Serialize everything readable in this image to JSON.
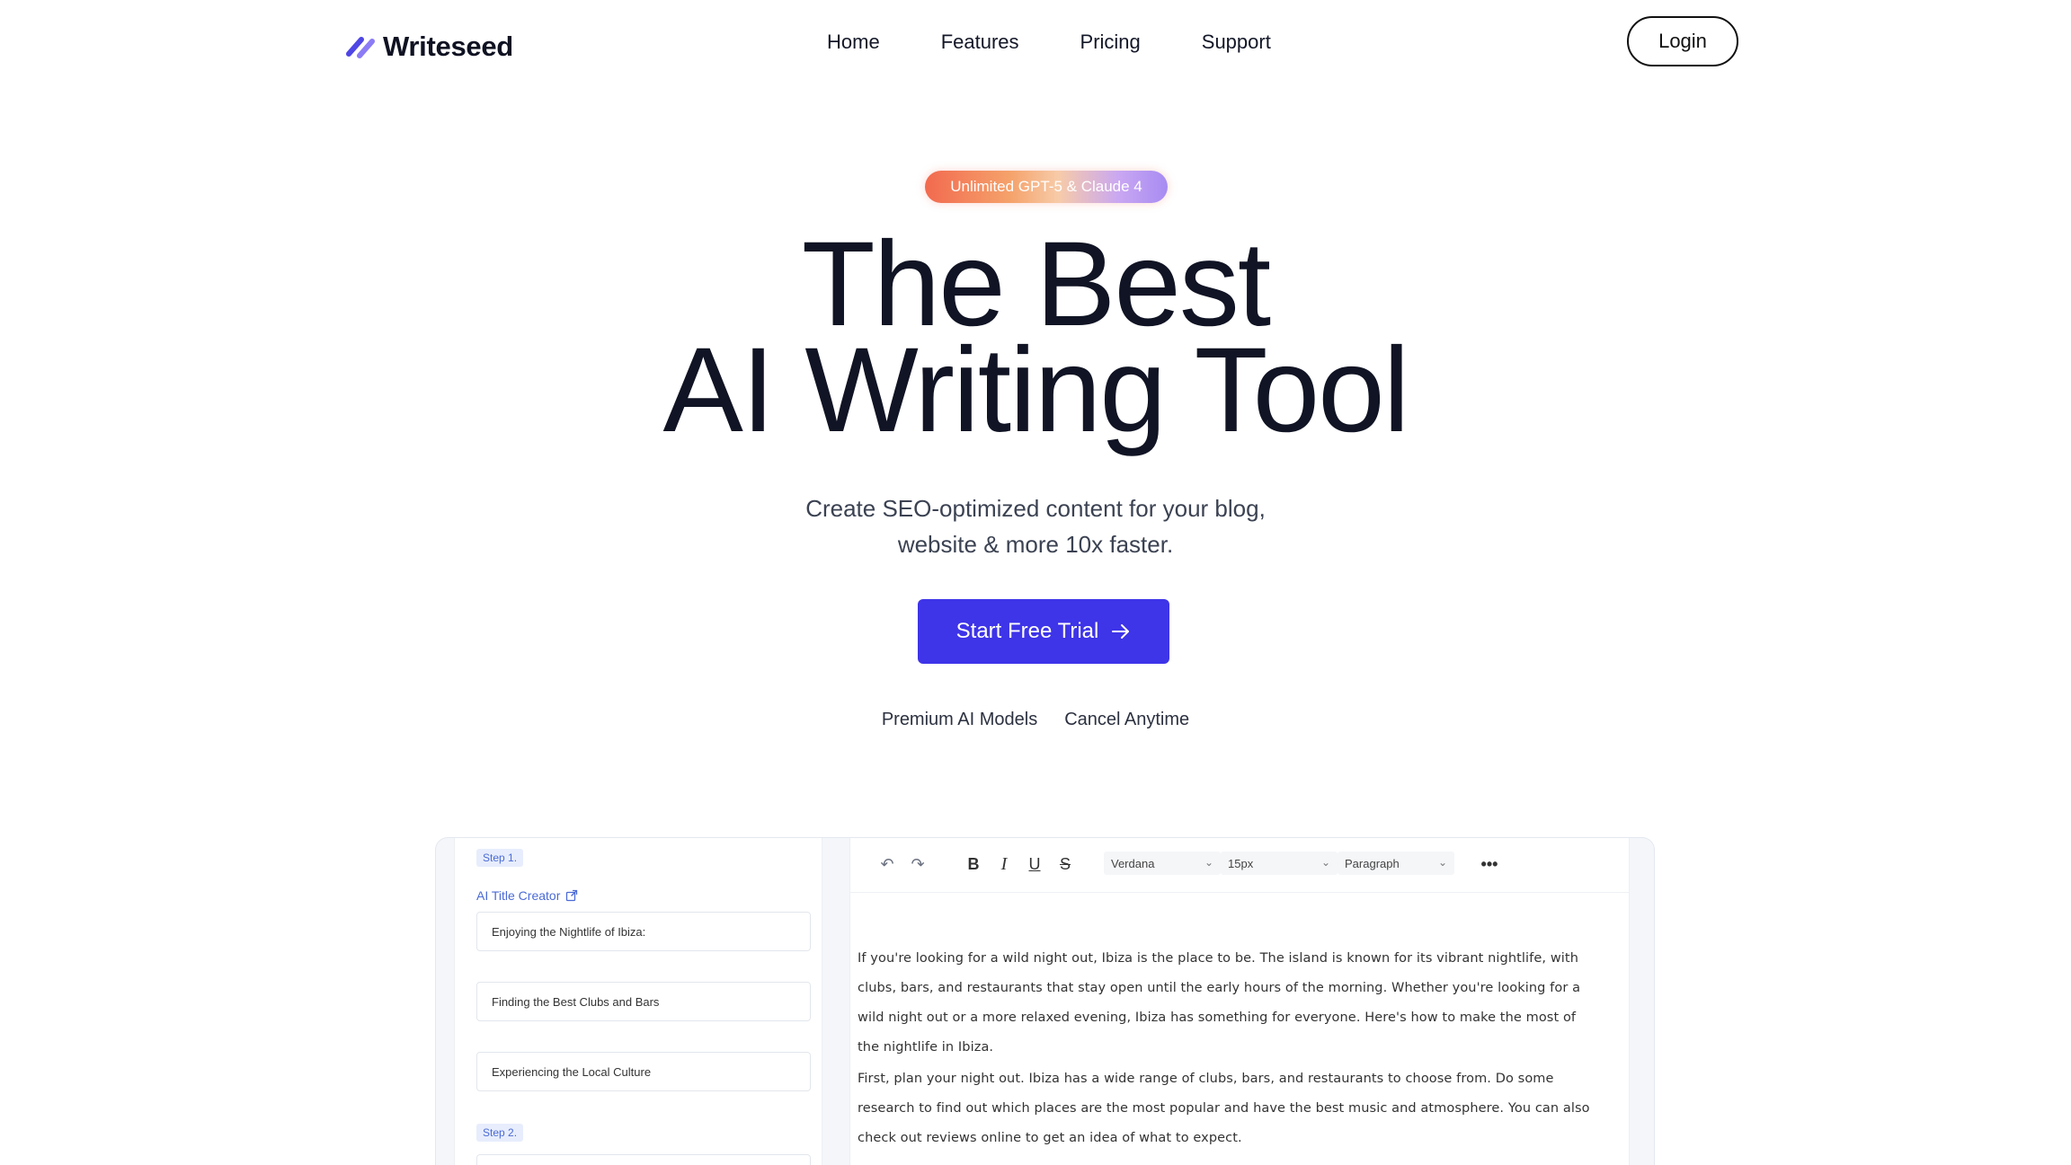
{
  "nav": {
    "brand": "Writeseed",
    "links": [
      "Home",
      "Features",
      "Pricing",
      "Support"
    ],
    "login_label": "Login"
  },
  "hero": {
    "badge": "Unlimited GPT-5 & Claude 4",
    "headline_line1": "The Best",
    "headline_line2": "AI Writing Tool",
    "subtitle_line1": "Create SEO-optimized content for your blog,",
    "subtitle_line2": "website & more 10x faster.",
    "cta_label": "Start Free Trial",
    "features": [
      "Premium AI Models",
      "Cancel Anytime"
    ]
  },
  "preview": {
    "left": {
      "step1": "Step 1.",
      "ai_title_label": "AI Title Creator",
      "titles": [
        "Enjoying the Nightlife of Ibiza:",
        "Finding the Best Clubs and Bars",
        "Experiencing the Local Culture"
      ],
      "step2": "Step 2."
    },
    "editor": {
      "font": "Verdana",
      "size": "15px",
      "block": "Paragraph",
      "paragraph1": [
        "If you're looking for a wild night out, Ibiza is the place to be. The island is known for its vibrant nightlife, with",
        "clubs, bars, and restaurants that stay open until the early hours of the morning. Whether you're looking for a",
        "wild night out or a more relaxed evening, Ibiza has something for everyone. Here's how to make the most of",
        "the nightlife in Ibiza."
      ],
      "paragraph2": [
        "First, plan your night out. Ibiza has a wide range of clubs, bars, and restaurants to choose from. Do some",
        "research to find out which places are the most popular and have the best music and atmosphere. You can also",
        "check out reviews online to get an idea of what to expect."
      ]
    }
  },
  "colors": {
    "primary": "#3e34e8",
    "text": "#101424",
    "step_blue": "#4b6bd6"
  }
}
